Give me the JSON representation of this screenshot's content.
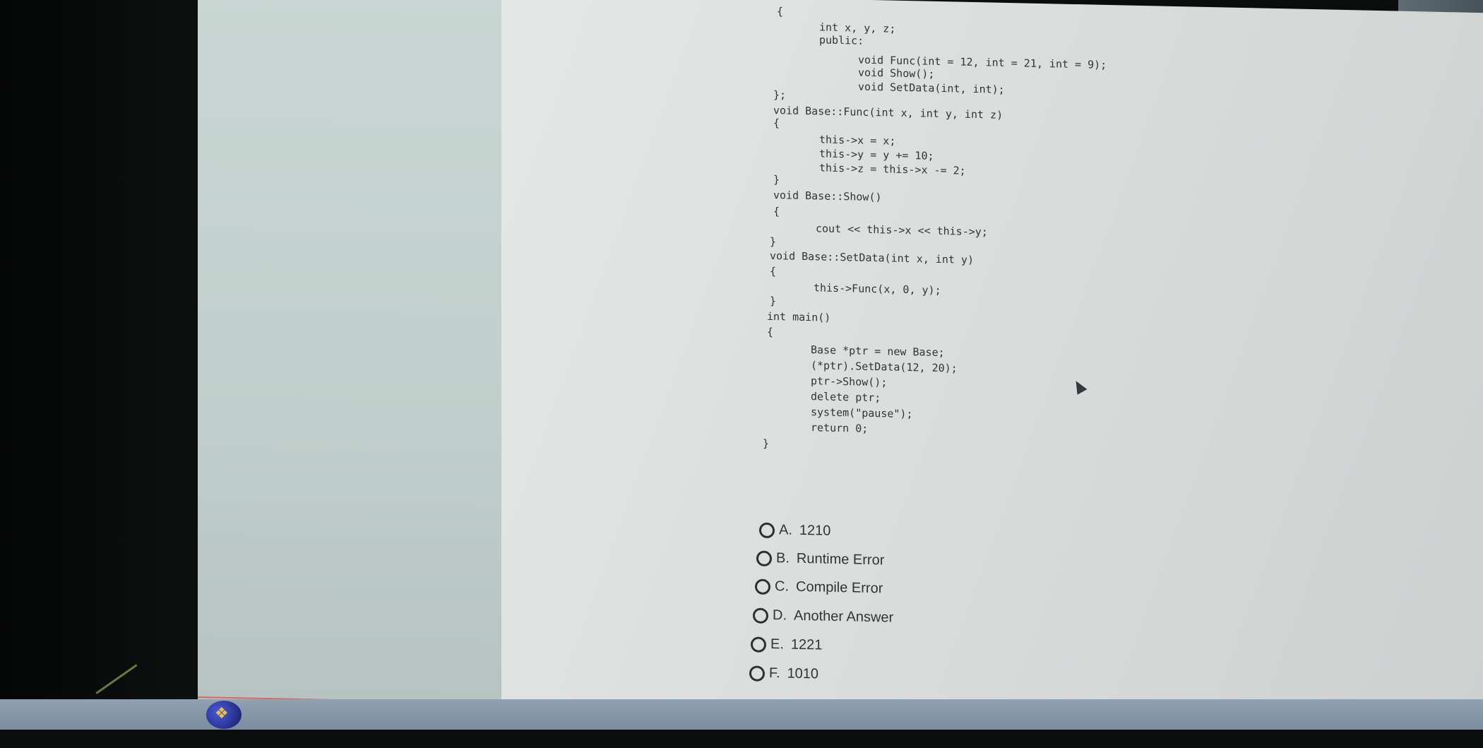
{
  "code_lines": [
    "{",
    "int x, y, z;",
    "public:",
    "void Func(int = 12, int = 21, int = 9);",
    "void Show();",
    "void SetData(int, int);",
    "};",
    "void Base::Func(int x, int y, int z)",
    "{",
    "this->x = x;",
    "this->y = y += 10;",
    "this->z = this->x -= 2;",
    "}",
    "void Base::Show()",
    "{",
    "cout << this->x << this->y;",
    "}",
    "void Base::SetData(int x, int y)",
    "{",
    "this->Func(x, 0, y);",
    "}",
    "int main()",
    "{",
    "Base *ptr = new Base;",
    "(*ptr).SetData(12, 20);",
    "ptr->Show();",
    "delete ptr;",
    "system(\"pause\");",
    "return 0;",
    "}"
  ],
  "options": [
    {
      "letter": "A.",
      "text": "1210"
    },
    {
      "letter": "B.",
      "text": "Runtime Error"
    },
    {
      "letter": "C.",
      "text": "Compile Error"
    },
    {
      "letter": "D.",
      "text": "Another Answer"
    },
    {
      "letter": "E.",
      "text": "1221"
    },
    {
      "letter": "F.",
      "text": "1010"
    }
  ],
  "taskbar": {
    "start_icon": "windows-start-icon"
  }
}
